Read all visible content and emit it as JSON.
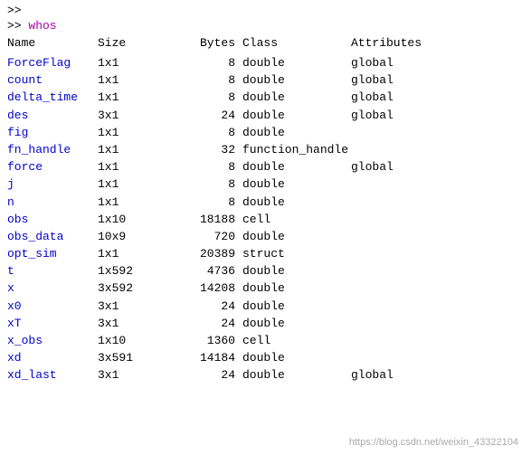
{
  "terminal": {
    "prompt": ">>",
    "command": "whos",
    "headers": {
      "name": "Name",
      "size": "Size",
      "bytes": "Bytes",
      "class": "Class",
      "attributes": "Attributes"
    },
    "rows": [
      {
        "name": "ForceFlag",
        "size": "1x1",
        "bytes": "8",
        "class": "double",
        "attributes": "global"
      },
      {
        "name": "count",
        "size": "1x1",
        "bytes": "8",
        "class": "double",
        "attributes": "global"
      },
      {
        "name": "delta_time",
        "size": "1x1",
        "bytes": "8",
        "class": "double",
        "attributes": "global"
      },
      {
        "name": "des",
        "size": "3x1",
        "bytes": "24",
        "class": "double",
        "attributes": "global"
      },
      {
        "name": "fig",
        "size": "1x1",
        "bytes": "8",
        "class": "double",
        "attributes": ""
      },
      {
        "name": "fn_handle",
        "size": "1x1",
        "bytes": "32",
        "class": "function_handle",
        "attributes": ""
      },
      {
        "name": "force",
        "size": "1x1",
        "bytes": "8",
        "class": "double",
        "attributes": "global"
      },
      {
        "name": "j",
        "size": "1x1",
        "bytes": "8",
        "class": "double",
        "attributes": ""
      },
      {
        "name": "n",
        "size": "1x1",
        "bytes": "8",
        "class": "double",
        "attributes": ""
      },
      {
        "name": "obs",
        "size": "1x10",
        "bytes": "18188",
        "class": "cell",
        "attributes": ""
      },
      {
        "name": "obs_data",
        "size": "10x9",
        "bytes": "720",
        "class": "double",
        "attributes": ""
      },
      {
        "name": "opt_sim",
        "size": "1x1",
        "bytes": "20389",
        "class": "struct",
        "attributes": ""
      },
      {
        "name": "t",
        "size": "1x592",
        "bytes": "4736",
        "class": "double",
        "attributes": ""
      },
      {
        "name": "x",
        "size": "3x592",
        "bytes": "14208",
        "class": "double",
        "attributes": ""
      },
      {
        "name": "x0",
        "size": "3x1",
        "bytes": "24",
        "class": "double",
        "attributes": ""
      },
      {
        "name": "xT",
        "size": "3x1",
        "bytes": "24",
        "class": "double",
        "attributes": ""
      },
      {
        "name": "x_obs",
        "size": "1x10",
        "bytes": "1360",
        "class": "cell",
        "attributes": ""
      },
      {
        "name": "xd",
        "size": "3x591",
        "bytes": "14184",
        "class": "double",
        "attributes": ""
      },
      {
        "name": "xd_last",
        "size": "3x1",
        "bytes": "24",
        "class": "double",
        "attributes": "global"
      }
    ],
    "watermark": "https://blog.csdn.net/weixin_43322104"
  }
}
